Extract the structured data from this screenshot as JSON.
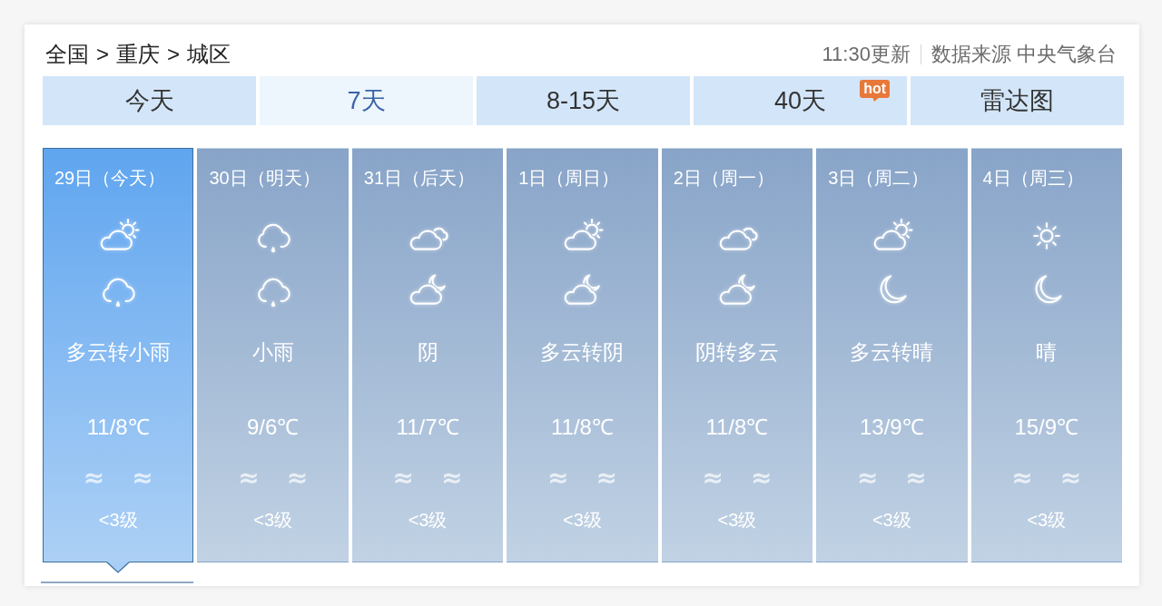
{
  "breadcrumb": {
    "items": [
      "全国",
      "重庆",
      "城区"
    ],
    "separator": ">"
  },
  "update_info": {
    "time": "11:30更新",
    "source": "数据来源 中央气象台"
  },
  "tabs": [
    {
      "label": "今天",
      "selected": false
    },
    {
      "label": "7天",
      "selected": true
    },
    {
      "label": "8-15天",
      "selected": false
    },
    {
      "label": "40天",
      "selected": false,
      "badge": "hot"
    },
    {
      "label": "雷达图",
      "selected": false
    }
  ],
  "days": [
    {
      "date": "29日（今天）",
      "selected": true,
      "icons": [
        {
          "kind": "partly_cloudy"
        },
        {
          "kind": "rain"
        }
      ],
      "weather": "多云转小雨",
      "temperature": "11/8℃",
      "wind_direction_marks": [
        "≈",
        "≈"
      ],
      "wind_level": "<3级"
    },
    {
      "date": "30日（明天）",
      "selected": false,
      "icons": [
        {
          "kind": "rain"
        },
        {
          "kind": "rain"
        }
      ],
      "weather": "小雨",
      "temperature": "9/6℃",
      "wind_direction_marks": [
        "≈",
        "≈"
      ],
      "wind_level": "<3级"
    },
    {
      "date": "31日（后天）",
      "selected": false,
      "icons": [
        {
          "kind": "overcast"
        },
        {
          "kind": "partly_cloudy_night"
        }
      ],
      "weather": "阴",
      "temperature": "11/7℃",
      "wind_direction_marks": [
        "≈",
        "≈"
      ],
      "wind_level": "<3级"
    },
    {
      "date": "1日（周日）",
      "selected": false,
      "icons": [
        {
          "kind": "partly_cloudy"
        },
        {
          "kind": "partly_cloudy_night"
        }
      ],
      "weather": "多云转阴",
      "temperature": "11/8℃",
      "wind_direction_marks": [
        "≈",
        "≈"
      ],
      "wind_level": "<3级"
    },
    {
      "date": "2日（周一）",
      "selected": false,
      "icons": [
        {
          "kind": "overcast"
        },
        {
          "kind": "partly_cloudy_night"
        }
      ],
      "weather": "阴转多云",
      "temperature": "11/8℃",
      "wind_direction_marks": [
        "≈",
        "≈"
      ],
      "wind_level": "<3级"
    },
    {
      "date": "3日（周二）",
      "selected": false,
      "icons": [
        {
          "kind": "partly_cloudy"
        },
        {
          "kind": "clear_night"
        }
      ],
      "weather": "多云转晴",
      "temperature": "13/9℃",
      "wind_direction_marks": [
        "≈",
        "≈"
      ],
      "wind_level": "<3级"
    },
    {
      "date": "4日（周三）",
      "selected": false,
      "icons": [
        {
          "kind": "sunny"
        },
        {
          "kind": "clear_night"
        }
      ],
      "weather": "晴",
      "temperature": "15/9℃",
      "wind_direction_marks": [
        "≈",
        "≈"
      ],
      "wind_level": "<3级"
    }
  ]
}
